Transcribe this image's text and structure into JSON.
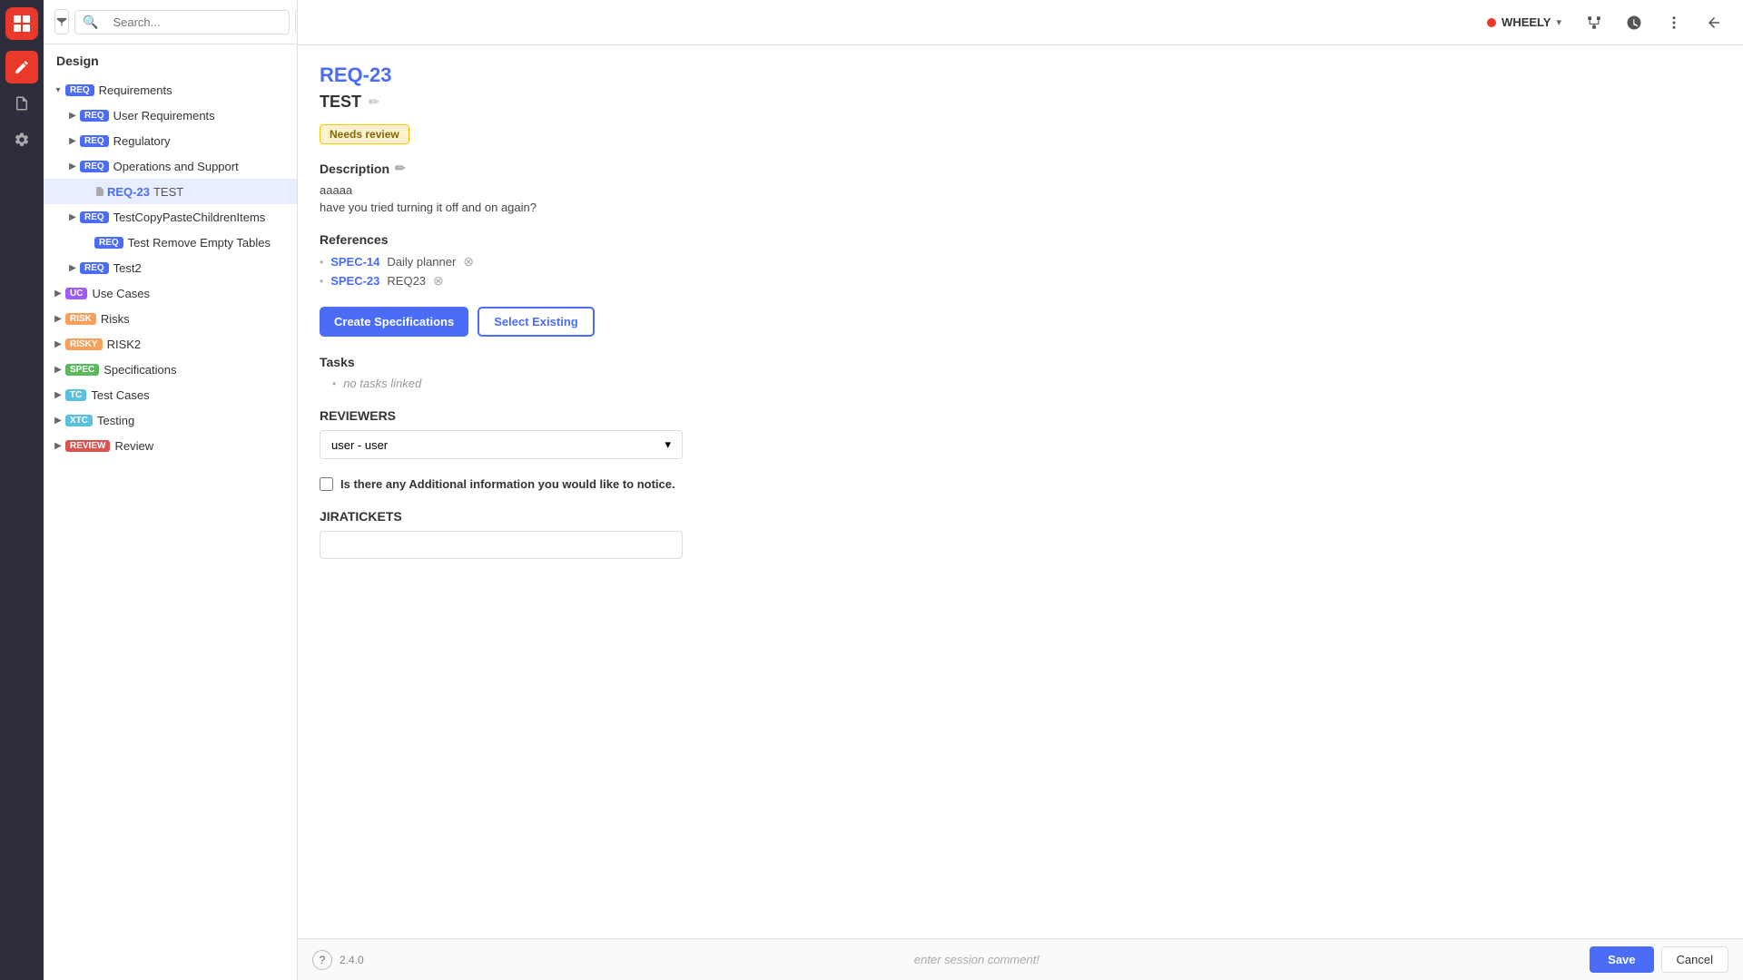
{
  "app": {
    "logo_alt": "Matrix Requirements",
    "version": "2.4.0"
  },
  "user": {
    "name": "WHEELY",
    "status_color": "#e8392a"
  },
  "sidebar": {
    "title": "Design",
    "search_placeholder": "Search...",
    "tree": [
      {
        "id": "req-root",
        "badge": "REQ",
        "badge_class": "badge-req",
        "label": "Requirements",
        "indent": 0,
        "toggle": true,
        "expanded": true
      },
      {
        "id": "req-user",
        "badge": "REQ",
        "badge_class": "badge-req",
        "label": "User Requirements",
        "indent": 1,
        "toggle": true,
        "expanded": false
      },
      {
        "id": "req-regulatory",
        "badge": "REQ",
        "badge_class": "badge-req",
        "label": "Regulatory",
        "indent": 1,
        "toggle": true,
        "expanded": false
      },
      {
        "id": "req-ops",
        "badge": "REQ",
        "badge_class": "badge-req",
        "label": "Operations and Support",
        "indent": 1,
        "toggle": true,
        "expanded": false
      },
      {
        "id": "req-23",
        "sub_badge": "REQ-23",
        "name": "TEST",
        "indent": 2,
        "active": true
      },
      {
        "id": "req-testcopy",
        "badge": "REQ",
        "badge_class": "badge-req",
        "label": "TestCopyPasteChildrenItems",
        "indent": 1,
        "toggle": true,
        "expanded": false
      },
      {
        "id": "req-remove",
        "badge": "REQ",
        "badge_class": "badge-req",
        "label": "Test Remove Empty Tables",
        "indent": 2,
        "toggle": false,
        "expanded": false
      },
      {
        "id": "req-test2",
        "badge": "REQ",
        "badge_class": "badge-req",
        "label": "Test2",
        "indent": 1,
        "toggle": true,
        "expanded": false
      },
      {
        "id": "uc-root",
        "badge": "UC",
        "badge_class": "badge-uc",
        "label": "Use Cases",
        "indent": 0,
        "toggle": true,
        "expanded": false
      },
      {
        "id": "risk-root",
        "badge": "RISK",
        "badge_class": "badge-risk",
        "label": "Risks",
        "indent": 0,
        "toggle": true,
        "expanded": false
      },
      {
        "id": "risky-root",
        "badge": "RISKY",
        "badge_class": "badge-risky",
        "label": "RISK2",
        "indent": 0,
        "toggle": true,
        "expanded": false
      },
      {
        "id": "spec-root",
        "badge": "SPEC",
        "badge_class": "badge-spec",
        "label": "Specifications",
        "indent": 0,
        "toggle": true,
        "expanded": false
      },
      {
        "id": "tc-root",
        "badge": "TC",
        "badge_class": "badge-tc",
        "label": "Test Cases",
        "indent": 0,
        "toggle": true,
        "expanded": false
      },
      {
        "id": "xtc-root",
        "badge": "XTC",
        "badge_class": "badge-xtc",
        "label": "Testing",
        "indent": 0,
        "toggle": true,
        "expanded": false
      },
      {
        "id": "review-root",
        "badge": "REVIEW",
        "badge_class": "badge-review",
        "label": "Review",
        "indent": 0,
        "toggle": true,
        "expanded": false
      }
    ]
  },
  "article": {
    "id": "REQ-23",
    "title": "TEST",
    "status": "Needs review",
    "description_label": "Description",
    "description_lines": [
      "aaaaa",
      "have you tried turning it off and on again?"
    ],
    "references_label": "References",
    "references": [
      {
        "id": "SPEC-14",
        "name": "Daily planner"
      },
      {
        "id": "SPEC-23",
        "name": "REQ23"
      }
    ],
    "btn_create": "Create Specifications",
    "btn_select": "Select Existing",
    "tasks_label": "Tasks",
    "tasks_none": "no tasks linked",
    "reviewers_label": "REVIEWERS",
    "reviewer_value": "user - user",
    "checkbox_label": "Is there any Additional information you would like to notice.",
    "jiratickets_label": "JIRATICKETS",
    "jiratickets_value": ""
  },
  "bottom_bar": {
    "version": "2.4.0",
    "session_comment_placeholder": "enter session comment!",
    "save_label": "Save",
    "cancel_label": "Cancel"
  },
  "icons": {
    "filter": "⊟",
    "chevron_down": "▾",
    "edit_pencil": "✏",
    "remove_x": "⊗",
    "help": "?",
    "tree_node": "📄",
    "history": "🕐",
    "more_vert": "⋮",
    "back_arrow": "←",
    "hierarchy": "⊞"
  }
}
